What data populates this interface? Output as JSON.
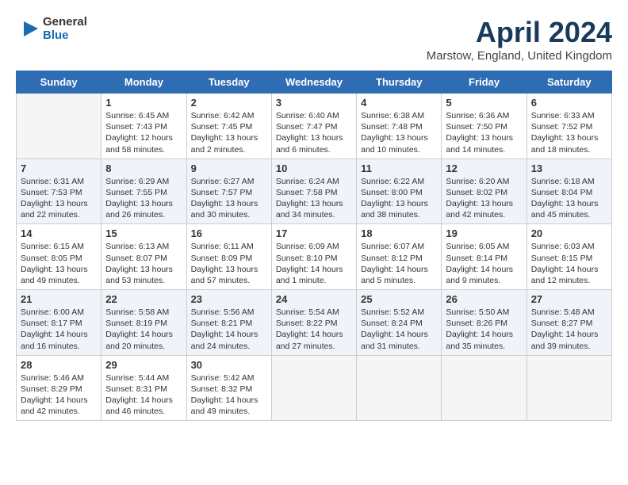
{
  "header": {
    "logo_general": "General",
    "logo_blue": "Blue",
    "month": "April 2024",
    "location": "Marstow, England, United Kingdom"
  },
  "days_of_week": [
    "Sunday",
    "Monday",
    "Tuesday",
    "Wednesday",
    "Thursday",
    "Friday",
    "Saturday"
  ],
  "weeks": [
    [
      {
        "day": "",
        "lines": [],
        "empty": true
      },
      {
        "day": "1",
        "lines": [
          "Sunrise: 6:45 AM",
          "Sunset: 7:43 PM",
          "Daylight: 12 hours",
          "and 58 minutes."
        ]
      },
      {
        "day": "2",
        "lines": [
          "Sunrise: 6:42 AM",
          "Sunset: 7:45 PM",
          "Daylight: 13 hours",
          "and 2 minutes."
        ]
      },
      {
        "day": "3",
        "lines": [
          "Sunrise: 6:40 AM",
          "Sunset: 7:47 PM",
          "Daylight: 13 hours",
          "and 6 minutes."
        ]
      },
      {
        "day": "4",
        "lines": [
          "Sunrise: 6:38 AM",
          "Sunset: 7:48 PM",
          "Daylight: 13 hours",
          "and 10 minutes."
        ]
      },
      {
        "day": "5",
        "lines": [
          "Sunrise: 6:36 AM",
          "Sunset: 7:50 PM",
          "Daylight: 13 hours",
          "and 14 minutes."
        ]
      },
      {
        "day": "6",
        "lines": [
          "Sunrise: 6:33 AM",
          "Sunset: 7:52 PM",
          "Daylight: 13 hours",
          "and 18 minutes."
        ]
      }
    ],
    [
      {
        "day": "7",
        "lines": [
          "Sunrise: 6:31 AM",
          "Sunset: 7:53 PM",
          "Daylight: 13 hours",
          "and 22 minutes."
        ]
      },
      {
        "day": "8",
        "lines": [
          "Sunrise: 6:29 AM",
          "Sunset: 7:55 PM",
          "Daylight: 13 hours",
          "and 26 minutes."
        ]
      },
      {
        "day": "9",
        "lines": [
          "Sunrise: 6:27 AM",
          "Sunset: 7:57 PM",
          "Daylight: 13 hours",
          "and 30 minutes."
        ]
      },
      {
        "day": "10",
        "lines": [
          "Sunrise: 6:24 AM",
          "Sunset: 7:58 PM",
          "Daylight: 13 hours",
          "and 34 minutes."
        ]
      },
      {
        "day": "11",
        "lines": [
          "Sunrise: 6:22 AM",
          "Sunset: 8:00 PM",
          "Daylight: 13 hours",
          "and 38 minutes."
        ]
      },
      {
        "day": "12",
        "lines": [
          "Sunrise: 6:20 AM",
          "Sunset: 8:02 PM",
          "Daylight: 13 hours",
          "and 42 minutes."
        ]
      },
      {
        "day": "13",
        "lines": [
          "Sunrise: 6:18 AM",
          "Sunset: 8:04 PM",
          "Daylight: 13 hours",
          "and 45 minutes."
        ]
      }
    ],
    [
      {
        "day": "14",
        "lines": [
          "Sunrise: 6:15 AM",
          "Sunset: 8:05 PM",
          "Daylight: 13 hours",
          "and 49 minutes."
        ]
      },
      {
        "day": "15",
        "lines": [
          "Sunrise: 6:13 AM",
          "Sunset: 8:07 PM",
          "Daylight: 13 hours",
          "and 53 minutes."
        ]
      },
      {
        "day": "16",
        "lines": [
          "Sunrise: 6:11 AM",
          "Sunset: 8:09 PM",
          "Daylight: 13 hours",
          "and 57 minutes."
        ]
      },
      {
        "day": "17",
        "lines": [
          "Sunrise: 6:09 AM",
          "Sunset: 8:10 PM",
          "Daylight: 14 hours",
          "and 1 minute."
        ]
      },
      {
        "day": "18",
        "lines": [
          "Sunrise: 6:07 AM",
          "Sunset: 8:12 PM",
          "Daylight: 14 hours",
          "and 5 minutes."
        ]
      },
      {
        "day": "19",
        "lines": [
          "Sunrise: 6:05 AM",
          "Sunset: 8:14 PM",
          "Daylight: 14 hours",
          "and 9 minutes."
        ]
      },
      {
        "day": "20",
        "lines": [
          "Sunrise: 6:03 AM",
          "Sunset: 8:15 PM",
          "Daylight: 14 hours",
          "and 12 minutes."
        ]
      }
    ],
    [
      {
        "day": "21",
        "lines": [
          "Sunrise: 6:00 AM",
          "Sunset: 8:17 PM",
          "Daylight: 14 hours",
          "and 16 minutes."
        ]
      },
      {
        "day": "22",
        "lines": [
          "Sunrise: 5:58 AM",
          "Sunset: 8:19 PM",
          "Daylight: 14 hours",
          "and 20 minutes."
        ]
      },
      {
        "day": "23",
        "lines": [
          "Sunrise: 5:56 AM",
          "Sunset: 8:21 PM",
          "Daylight: 14 hours",
          "and 24 minutes."
        ]
      },
      {
        "day": "24",
        "lines": [
          "Sunrise: 5:54 AM",
          "Sunset: 8:22 PM",
          "Daylight: 14 hours",
          "and 27 minutes."
        ]
      },
      {
        "day": "25",
        "lines": [
          "Sunrise: 5:52 AM",
          "Sunset: 8:24 PM",
          "Daylight: 14 hours",
          "and 31 minutes."
        ]
      },
      {
        "day": "26",
        "lines": [
          "Sunrise: 5:50 AM",
          "Sunset: 8:26 PM",
          "Daylight: 14 hours",
          "and 35 minutes."
        ]
      },
      {
        "day": "27",
        "lines": [
          "Sunrise: 5:48 AM",
          "Sunset: 8:27 PM",
          "Daylight: 14 hours",
          "and 39 minutes."
        ]
      }
    ],
    [
      {
        "day": "28",
        "lines": [
          "Sunrise: 5:46 AM",
          "Sunset: 8:29 PM",
          "Daylight: 14 hours",
          "and 42 minutes."
        ]
      },
      {
        "day": "29",
        "lines": [
          "Sunrise: 5:44 AM",
          "Sunset: 8:31 PM",
          "Daylight: 14 hours",
          "and 46 minutes."
        ]
      },
      {
        "day": "30",
        "lines": [
          "Sunrise: 5:42 AM",
          "Sunset: 8:32 PM",
          "Daylight: 14 hours",
          "and 49 minutes."
        ]
      },
      {
        "day": "",
        "lines": [],
        "empty": true
      },
      {
        "day": "",
        "lines": [],
        "empty": true
      },
      {
        "day": "",
        "lines": [],
        "empty": true
      },
      {
        "day": "",
        "lines": [],
        "empty": true
      }
    ]
  ]
}
